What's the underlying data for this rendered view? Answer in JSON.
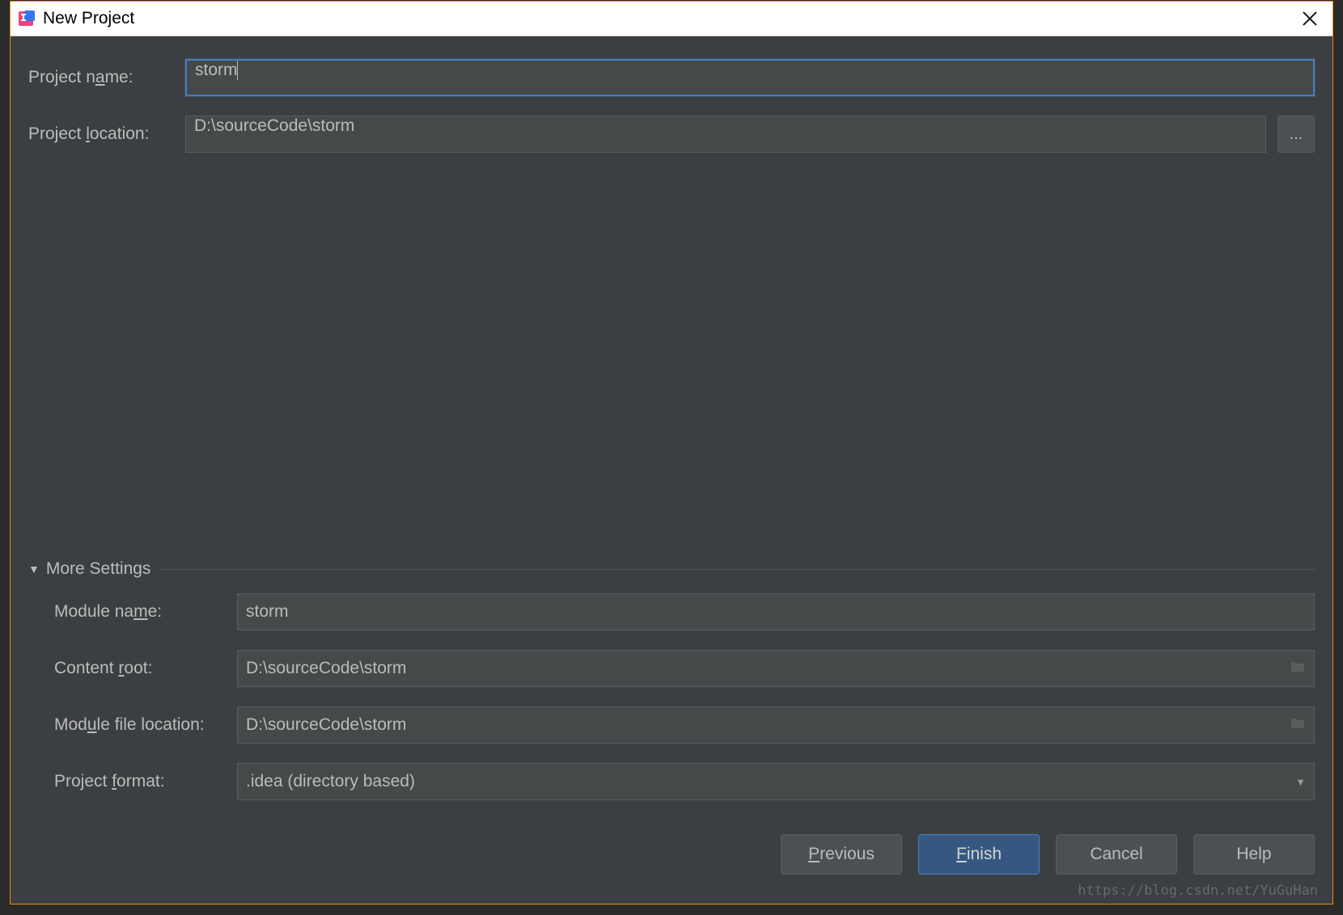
{
  "titlebar": {
    "title": "New Project"
  },
  "form": {
    "project_name_label_pre": "Project n",
    "project_name_label_mn": "a",
    "project_name_label_post": "me:",
    "project_name_value": "storm",
    "project_location_label_pre": "Project ",
    "project_location_label_mn": "l",
    "project_location_label_post": "ocation:",
    "project_location_value": "D:\\sourceCode\\storm",
    "browse_label": "..."
  },
  "more": {
    "header_pre": "Mor",
    "header_mn": "e",
    "header_post": " Settings",
    "module_name_label_pre": "Module na",
    "module_name_label_mn": "m",
    "module_name_label_post": "e:",
    "module_name_value": "storm",
    "content_root_label_pre": "Content ",
    "content_root_label_mn": "r",
    "content_root_label_post": "oot:",
    "content_root_value": "D:\\sourceCode\\storm",
    "module_file_loc_label_pre": "Mod",
    "module_file_loc_label_mn": "u",
    "module_file_loc_label_post": "le file location:",
    "module_file_loc_value": "D:\\sourceCode\\storm",
    "project_format_label_pre": "Project ",
    "project_format_label_mn": "f",
    "project_format_label_post": "ormat:",
    "project_format_value": ".idea (directory based)"
  },
  "buttons": {
    "previous_mn": "P",
    "previous_post": "revious",
    "finish_mn": "F",
    "finish_post": "inish",
    "cancel": "Cancel",
    "help": "Help"
  },
  "watermark": "https://blog.csdn.net/YuGuHan"
}
